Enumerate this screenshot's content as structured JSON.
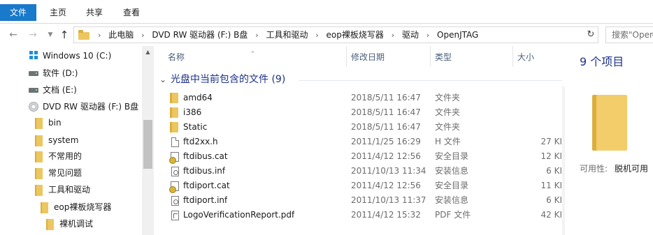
{
  "ribbon": {
    "tabs": [
      "文件",
      "主页",
      "共享",
      "查看"
    ]
  },
  "breadcrumb": [
    "此电脑",
    "DVD RW 驱动器 (F:) B盘",
    "工具和驱动",
    "eop裸板烧写器",
    "驱动",
    "OpenJTAG"
  ],
  "search": {
    "placeholder": "搜索\"OpenJTAG\""
  },
  "nav_tree": [
    {
      "label": "Windows 10 (C:)",
      "icon": "windows-drive-icon"
    },
    {
      "label": "软件 (D:)",
      "icon": "drive-icon"
    },
    {
      "label": "文档 (E:)",
      "icon": "drive-icon"
    },
    {
      "label": "DVD RW 驱动器 (F:) B盘",
      "icon": "dvd-drive-icon"
    },
    {
      "label": "bin",
      "icon": "folder-icon"
    },
    {
      "label": "system",
      "icon": "folder-icon"
    },
    {
      "label": "不常用的",
      "icon": "folder-icon"
    },
    {
      "label": "常见问题",
      "icon": "folder-icon"
    },
    {
      "label": "工具和驱动",
      "icon": "folder-icon"
    },
    {
      "label": "eop裸板烧写器",
      "icon": "folder-icon"
    },
    {
      "label": "裸机调试",
      "icon": "folder-icon"
    }
  ],
  "columns": {
    "name": "名称",
    "date": "修改日期",
    "type": "类型",
    "size": "大小"
  },
  "group": {
    "title": "光盘中当前包含的文件 (9)"
  },
  "files": [
    {
      "name": "amd64",
      "date": "2018/5/11 16:47",
      "type": "文件夹",
      "size": "",
      "icon": "folder-icon"
    },
    {
      "name": "i386",
      "date": "2018/5/11 16:47",
      "type": "文件夹",
      "size": "",
      "icon": "folder-icon"
    },
    {
      "name": "Static",
      "date": "2018/5/11 16:47",
      "type": "文件夹",
      "size": "",
      "icon": "folder-icon"
    },
    {
      "name": "ftd2xx.h",
      "date": "2011/1/25 16:29",
      "type": "H 文件",
      "size": "27 KI",
      "icon": "document-icon"
    },
    {
      "name": "ftdibus.cat",
      "date": "2011/4/12 12:56",
      "type": "安全目录",
      "size": "12 KI",
      "icon": "security-catalog-icon"
    },
    {
      "name": "ftdibus.inf",
      "date": "2011/10/13 11:34",
      "type": "安装信息",
      "size": "6 KI",
      "icon": "setup-info-icon"
    },
    {
      "name": "ftdiport.cat",
      "date": "2011/4/12 12:56",
      "type": "安全目录",
      "size": "11 KI",
      "icon": "security-catalog-icon"
    },
    {
      "name": "ftdiport.inf",
      "date": "2011/10/13 11:37",
      "type": "安装信息",
      "size": "6 KI",
      "icon": "setup-info-icon"
    },
    {
      "name": "LogoVerificationReport.pdf",
      "date": "2011/4/12 15:32",
      "type": "PDF 文件",
      "size": "42 KI",
      "icon": "pdf-icon"
    }
  ],
  "details": {
    "count": "9 个项目",
    "availability_label": "可用性:",
    "availability_value": "脱机可用"
  },
  "colors": {
    "accent": "#1979ca",
    "folder": "#ecc65f",
    "group_header": "#1e3287"
  }
}
